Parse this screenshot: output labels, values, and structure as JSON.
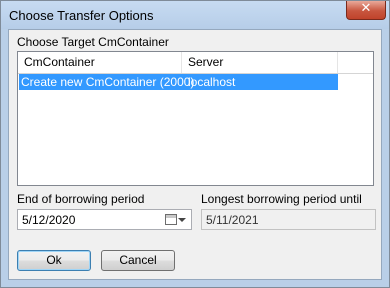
{
  "window": {
    "title": "Choose Transfer Options",
    "close_glyph": "✕"
  },
  "target": {
    "label": "Choose Target CmContainer",
    "columns": [
      "CmContainer",
      "Server"
    ],
    "rows": [
      {
        "container": "Create new CmContainer (2000)",
        "server": "localhost",
        "selected": true
      }
    ]
  },
  "borrowing": {
    "end_label": "End of borrowing period",
    "end_value": "5/12/2020",
    "longest_label": "Longest borrowing period until",
    "longest_value": "5/11/2021"
  },
  "buttons": {
    "ok": "Ok",
    "cancel": "Cancel"
  },
  "icons": {
    "calendar": "calendar-icon",
    "dropdown": "chevron-down-icon",
    "close": "close-icon"
  },
  "colors": {
    "selection": "#3399ff",
    "title_bar": "#b9cfe8",
    "close_button": "#c8563f"
  }
}
